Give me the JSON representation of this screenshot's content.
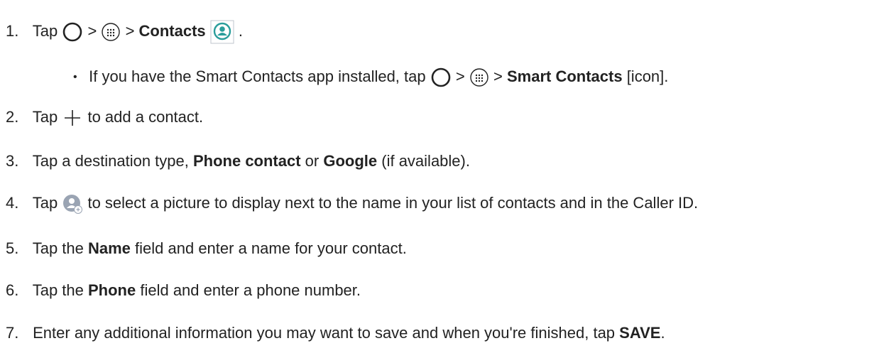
{
  "steps": [
    {
      "num": "1.",
      "t1": "Tap",
      "t2": ">",
      "t3": ">",
      "b1": "Contacts",
      "t4": "."
    },
    {
      "num": "2.",
      "t1": "Tap",
      "t2": "to add a contact."
    },
    {
      "num": "3.",
      "t1": "Tap a destination type, ",
      "b1": "Phone contact",
      "t2": " or ",
      "b2": "Google",
      "t3": " (if available)."
    },
    {
      "num": "4.",
      "t1": "Tap",
      "t2": "to select a picture to display next to the name in your list of contacts and in the Caller ID."
    },
    {
      "num": "5.",
      "t1": "Tap the ",
      "b1": "Name",
      "t2": " field and enter a name for your contact."
    },
    {
      "num": "6.",
      "t1": "Tap the ",
      "b1": "Phone",
      "t2": " field and enter a phone number."
    },
    {
      "num": "7.",
      "t1": "Enter any additional information you may want to save and when you're finished, tap ",
      "b1": "SAVE",
      "t2": "."
    }
  ],
  "substep": {
    "bullet": "•",
    "t1": "If you have the Smart Contacts app installed, tap",
    "t2": ">",
    "t3": ">",
    "b1": "Smart Contacts",
    "t4": " [icon]."
  },
  "icons": {
    "home": "circle-home-icon",
    "apps": "apps-grid-icon",
    "contacts": "contacts-app-icon",
    "add": "plus-icon",
    "picture": "add-picture-icon"
  },
  "colors": {
    "text": "#222222",
    "contacts_icon": "#2a9d9b",
    "picture_icon": "#9aa4b3"
  }
}
